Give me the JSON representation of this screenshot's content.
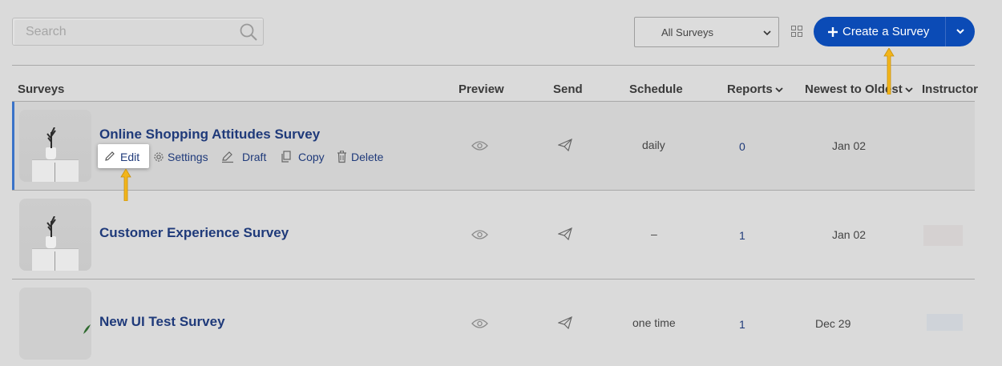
{
  "search": {
    "placeholder": "Search"
  },
  "filter": {
    "selected": "All Surveys"
  },
  "create_button": {
    "label": "Create a Survey"
  },
  "table": {
    "headers": {
      "surveys": "Surveys",
      "preview": "Preview",
      "send": "Send",
      "schedule": "Schedule",
      "reports": "Reports",
      "sort": "Newest to Oldest",
      "instructor": "Instructor"
    },
    "row_actions": {
      "edit": "Edit",
      "settings": "Settings",
      "draft": "Draft",
      "copy": "Copy",
      "delete": "Delete"
    },
    "rows": [
      {
        "title": "Online Shopping Attitudes Survey",
        "schedule": "daily",
        "reports": "0",
        "date": "Jan 02"
      },
      {
        "title": "Customer Experience Survey",
        "schedule": "–",
        "reports": "1",
        "date": "Jan 02"
      },
      {
        "title": "New UI Test Survey",
        "schedule": "one time",
        "reports": "1",
        "date": "Dec 29"
      }
    ]
  },
  "colors": {
    "accent": "#0b4bb6",
    "link": "#1f3a7a",
    "annotation_arrow": "#f2b51b",
    "background": "#dadada"
  },
  "icons": [
    "search-icon",
    "chevron-down-icon",
    "grid-view-icon",
    "plus-icon",
    "eye-icon",
    "send-icon",
    "pencil-icon",
    "gear-icon",
    "draft-icon",
    "copy-icon",
    "trash-icon"
  ]
}
